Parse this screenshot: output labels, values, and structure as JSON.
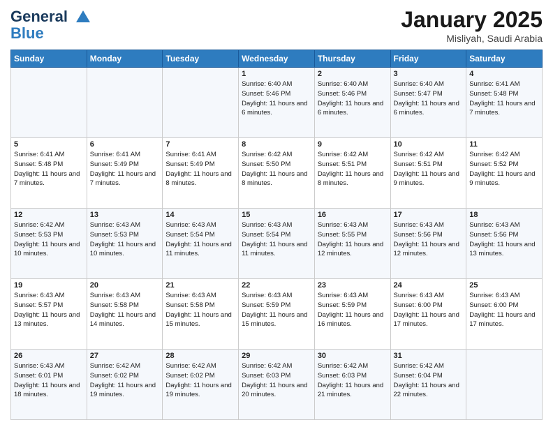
{
  "header": {
    "logo_line1": "General",
    "logo_line2": "Blue",
    "month_title": "January 2025",
    "location": "Misliyah, Saudi Arabia"
  },
  "days_of_week": [
    "Sunday",
    "Monday",
    "Tuesday",
    "Wednesday",
    "Thursday",
    "Friday",
    "Saturday"
  ],
  "weeks": [
    [
      {
        "day": "",
        "info": ""
      },
      {
        "day": "",
        "info": ""
      },
      {
        "day": "",
        "info": ""
      },
      {
        "day": "1",
        "info": "Sunrise: 6:40 AM\nSunset: 5:46 PM\nDaylight: 11 hours and 6 minutes."
      },
      {
        "day": "2",
        "info": "Sunrise: 6:40 AM\nSunset: 5:46 PM\nDaylight: 11 hours and 6 minutes."
      },
      {
        "day": "3",
        "info": "Sunrise: 6:40 AM\nSunset: 5:47 PM\nDaylight: 11 hours and 6 minutes."
      },
      {
        "day": "4",
        "info": "Sunrise: 6:41 AM\nSunset: 5:48 PM\nDaylight: 11 hours and 7 minutes."
      }
    ],
    [
      {
        "day": "5",
        "info": "Sunrise: 6:41 AM\nSunset: 5:48 PM\nDaylight: 11 hours and 7 minutes."
      },
      {
        "day": "6",
        "info": "Sunrise: 6:41 AM\nSunset: 5:49 PM\nDaylight: 11 hours and 7 minutes."
      },
      {
        "day": "7",
        "info": "Sunrise: 6:41 AM\nSunset: 5:49 PM\nDaylight: 11 hours and 8 minutes."
      },
      {
        "day": "8",
        "info": "Sunrise: 6:42 AM\nSunset: 5:50 PM\nDaylight: 11 hours and 8 minutes."
      },
      {
        "day": "9",
        "info": "Sunrise: 6:42 AM\nSunset: 5:51 PM\nDaylight: 11 hours and 8 minutes."
      },
      {
        "day": "10",
        "info": "Sunrise: 6:42 AM\nSunset: 5:51 PM\nDaylight: 11 hours and 9 minutes."
      },
      {
        "day": "11",
        "info": "Sunrise: 6:42 AM\nSunset: 5:52 PM\nDaylight: 11 hours and 9 minutes."
      }
    ],
    [
      {
        "day": "12",
        "info": "Sunrise: 6:42 AM\nSunset: 5:53 PM\nDaylight: 11 hours and 10 minutes."
      },
      {
        "day": "13",
        "info": "Sunrise: 6:43 AM\nSunset: 5:53 PM\nDaylight: 11 hours and 10 minutes."
      },
      {
        "day": "14",
        "info": "Sunrise: 6:43 AM\nSunset: 5:54 PM\nDaylight: 11 hours and 11 minutes."
      },
      {
        "day": "15",
        "info": "Sunrise: 6:43 AM\nSunset: 5:54 PM\nDaylight: 11 hours and 11 minutes."
      },
      {
        "day": "16",
        "info": "Sunrise: 6:43 AM\nSunset: 5:55 PM\nDaylight: 11 hours and 12 minutes."
      },
      {
        "day": "17",
        "info": "Sunrise: 6:43 AM\nSunset: 5:56 PM\nDaylight: 11 hours and 12 minutes."
      },
      {
        "day": "18",
        "info": "Sunrise: 6:43 AM\nSunset: 5:56 PM\nDaylight: 11 hours and 13 minutes."
      }
    ],
    [
      {
        "day": "19",
        "info": "Sunrise: 6:43 AM\nSunset: 5:57 PM\nDaylight: 11 hours and 13 minutes."
      },
      {
        "day": "20",
        "info": "Sunrise: 6:43 AM\nSunset: 5:58 PM\nDaylight: 11 hours and 14 minutes."
      },
      {
        "day": "21",
        "info": "Sunrise: 6:43 AM\nSunset: 5:58 PM\nDaylight: 11 hours and 15 minutes."
      },
      {
        "day": "22",
        "info": "Sunrise: 6:43 AM\nSunset: 5:59 PM\nDaylight: 11 hours and 15 minutes."
      },
      {
        "day": "23",
        "info": "Sunrise: 6:43 AM\nSunset: 5:59 PM\nDaylight: 11 hours and 16 minutes."
      },
      {
        "day": "24",
        "info": "Sunrise: 6:43 AM\nSunset: 6:00 PM\nDaylight: 11 hours and 17 minutes."
      },
      {
        "day": "25",
        "info": "Sunrise: 6:43 AM\nSunset: 6:00 PM\nDaylight: 11 hours and 17 minutes."
      }
    ],
    [
      {
        "day": "26",
        "info": "Sunrise: 6:43 AM\nSunset: 6:01 PM\nDaylight: 11 hours and 18 minutes."
      },
      {
        "day": "27",
        "info": "Sunrise: 6:42 AM\nSunset: 6:02 PM\nDaylight: 11 hours and 19 minutes."
      },
      {
        "day": "28",
        "info": "Sunrise: 6:42 AM\nSunset: 6:02 PM\nDaylight: 11 hours and 19 minutes."
      },
      {
        "day": "29",
        "info": "Sunrise: 6:42 AM\nSunset: 6:03 PM\nDaylight: 11 hours and 20 minutes."
      },
      {
        "day": "30",
        "info": "Sunrise: 6:42 AM\nSunset: 6:03 PM\nDaylight: 11 hours and 21 minutes."
      },
      {
        "day": "31",
        "info": "Sunrise: 6:42 AM\nSunset: 6:04 PM\nDaylight: 11 hours and 22 minutes."
      },
      {
        "day": "",
        "info": ""
      }
    ]
  ]
}
